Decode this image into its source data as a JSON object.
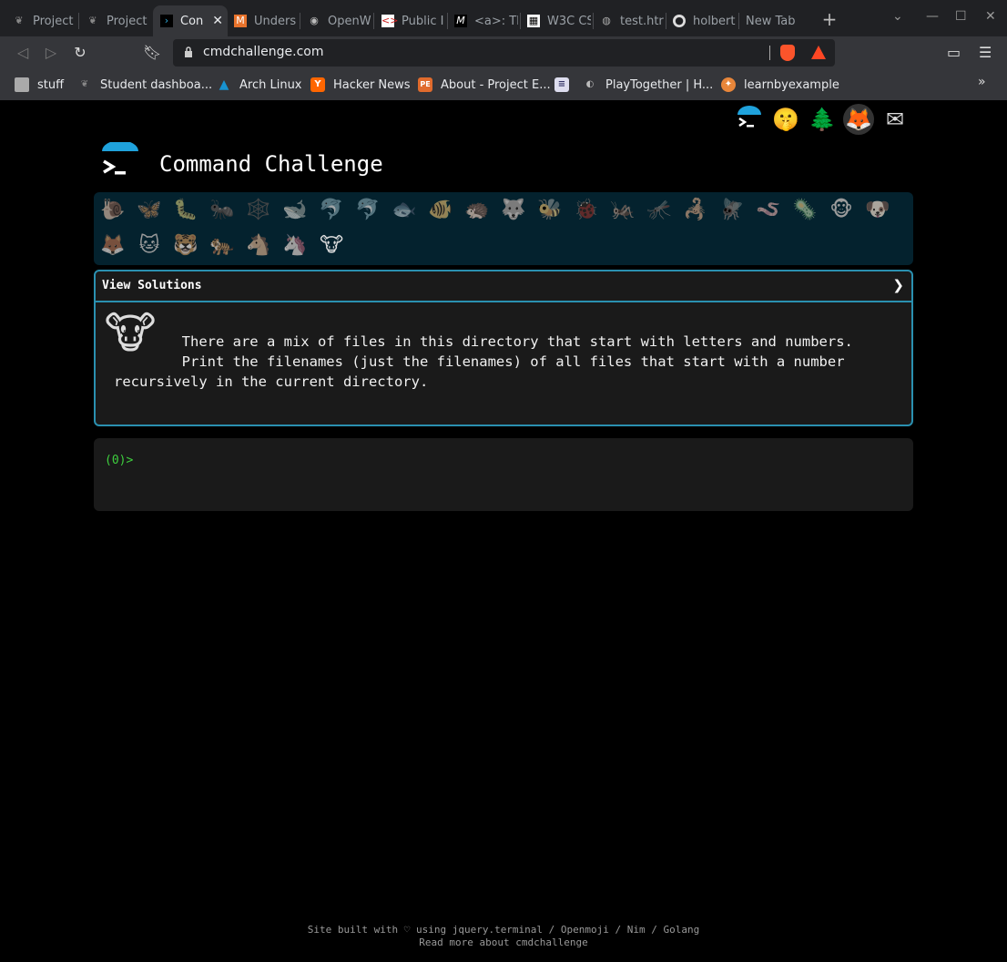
{
  "browser": {
    "tabs": [
      {
        "label": "Project",
        "icon": "feather-icon"
      },
      {
        "label": "Project",
        "icon": "feather-icon"
      },
      {
        "label": "Con",
        "icon": "terminal-icon",
        "active": true
      },
      {
        "label": "Unders",
        "icon": "m-icon"
      },
      {
        "label": "OpenW",
        "icon": "radio-icon"
      },
      {
        "label": "Public I",
        "icon": "code-icon"
      },
      {
        "label": "<a>: Th",
        "icon": "mdn-icon"
      },
      {
        "label": "W3C CS",
        "icon": "w3c-icon"
      },
      {
        "label": "test.htr",
        "icon": "globe-icon"
      },
      {
        "label": "holbert",
        "icon": "github-icon"
      },
      {
        "label": "New Tab",
        "icon": ""
      }
    ],
    "url": "cmdchallenge.com",
    "bookmarks": [
      {
        "label": "stuff",
        "icon": "folder-icon"
      },
      {
        "label": "Student dashboa...",
        "icon": "feather-icon"
      },
      {
        "label": "Arch Linux",
        "icon": "arch-icon"
      },
      {
        "label": "Hacker News",
        "icon": "y-icon"
      },
      {
        "label": "About - Project E...",
        "icon": "pe-icon"
      },
      {
        "label": "",
        "icon": "doc-icon"
      },
      {
        "label": "PlayTogether | H...",
        "icon": "game-icon"
      },
      {
        "label": "learnbyexample",
        "icon": "lbe-icon"
      }
    ]
  },
  "site": {
    "title": "Command Challenge",
    "top_icons": [
      "terminal-logo-icon",
      "shush-face-icon",
      "tree-icon",
      "gitlab-icon",
      "envelope-icon"
    ],
    "animals": [
      "🐌",
      "🦋",
      "🐛",
      "🐜",
      "🕸️",
      "🐋",
      "🐬",
      "🐬",
      "🐟",
      "🐠",
      "🦔",
      "🐺",
      "🐝",
      "🐞",
      "🦗",
      "🦟",
      "🦂",
      "🪰",
      "🪱",
      "🦠",
      "🐵",
      "🐶",
      "🦊",
      "🐱",
      "🐯",
      "🐅",
      "🐴",
      "🦄",
      "🐮"
    ],
    "view_solutions": "View Solutions",
    "chevron": "❯",
    "challenge_text": "        There are a mix of files in this directory that start with letters and numbers.\n        Print the filenames (just the filenames) of all files that start with a number\nrecursively in the current directory.",
    "prompt": "(0)>",
    "footer_line1": "Site built with ♡ using jquery.terminal / Openmoji / Nim / Golang",
    "footer_line2": "Read more about cmdchallenge"
  }
}
